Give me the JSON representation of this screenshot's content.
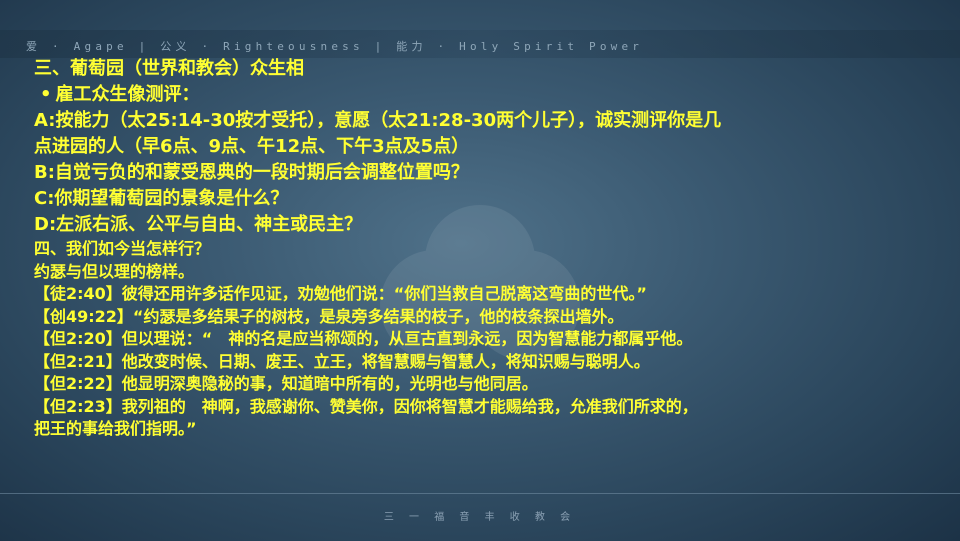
{
  "header": {
    "banner": "爱 · Agape  |  公义 · Righteousness  |  能力 · Holy Spirit Power"
  },
  "footer": {
    "church": "三 一 福 音 丰 收 教 会"
  },
  "slide": {
    "section3_title": "三、葡萄园（世界和教会）众生相",
    "bullet_symbol": "•",
    "bullet_text": "雇工众生像测评：",
    "item_a_1": "A:按能力（太25:14-30按才受托），意愿（太21:28-30两个儿子），诚实测评你是几",
    "item_a_2": "点进园的人（早6点、9点、午12点、下午3点及5点）",
    "item_b": "B:自觉亏负的和蒙受恩典的一段时期后会调整位置吗？",
    "item_c": "C:你期望葡萄园的景象是什么？",
    "item_d": "D:左派右派、公平与自由、神主或民主？",
    "section4_title": "四、我们如今当怎样行？",
    "section4_sub": "约瑟与但以理的榜样。",
    "verses": [
      "【徒2:40】彼得还用许多话作见证，劝勉他们说：“你们当救自己脱离这弯曲的世代。”",
      "【创49:22】“约瑟是多结果子的树枝，是泉旁多结果的枝子，他的枝条探出墙外。",
      "【但2:20】但以理说：“　神的名是应当称颂的，从亘古直到永远，因为智慧能力都属乎他。",
      "【但2:21】他改变时候、日期、废王、立王，将智慧赐与智慧人，将知识赐与聪明人。",
      "【但2:22】他显明深奥隐秘的事，知道暗中所有的，光明也与他同居。",
      "【但2:23】我列祖的　神啊，我感谢你、赞美你，因你将智慧才能赐给我，允准我们所求的，",
      "把王的事给我们指明。”"
    ]
  }
}
